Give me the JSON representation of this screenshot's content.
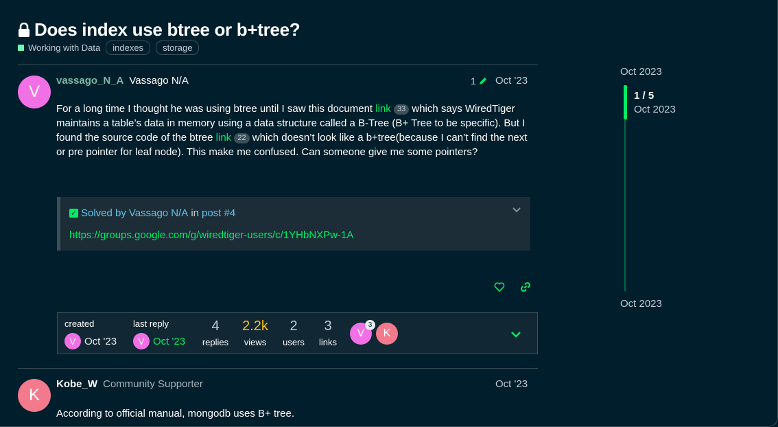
{
  "topic": {
    "title": "Does index use btree or b+tree?",
    "category": "Working with Data",
    "tags": [
      "indexes",
      "storage"
    ]
  },
  "colors": {
    "background": "#001e2b",
    "accent_green": "#00ed64",
    "category": "#71f6ba",
    "views_hot": "#ffc010"
  },
  "post1": {
    "avatar_letter": "V",
    "username": "vassago_N_A",
    "fullname": "Vassago N/A",
    "edits": "1",
    "date": "Oct '23",
    "text_1": "For a long time I thought he was using btree until I saw this document ",
    "link_1": "link",
    "link_1_clicks": "33",
    "text_2": " which says WiredTiger maintains a table’s data in memory using a data structure called a B-Tree (B+ Tree to be specific). But I found the source code of the btree ",
    "link_2": "link",
    "link_2_clicks": "22",
    "text_3": " which doesn’t look like a b+tree(because I can’t find the next or pre pointer for leaf node). This make me confused. Can someone give me some pointers?",
    "solution": {
      "solved_by": "Solved by",
      "author": "Vassago N/A",
      "in": "in",
      "post_ref": "post #4",
      "url": "https://groups.google.com/g/wiredtiger-users/c/1YHbNXPw-1A"
    }
  },
  "topic_map": {
    "created_label": "created",
    "created_date": "Oct '23",
    "last_reply_label": "last reply",
    "last_reply_date": "Oct '23",
    "replies": "4",
    "replies_label": "replies",
    "views": "2.2k",
    "views_label": "views",
    "users": "2",
    "users_label": "users",
    "links": "3",
    "links_label": "links",
    "participants": [
      {
        "letter": "V",
        "count": "3"
      },
      {
        "letter": "K",
        "count": ""
      }
    ]
  },
  "post2": {
    "avatar_letter": "K",
    "username": "Kobe_W",
    "user_title": "Community Supporter",
    "date": "Oct '23",
    "text": "According to official manual, mongodb uses B+ tree."
  },
  "timeline": {
    "start_date": "Oct 2023",
    "position": "1 / 5",
    "position_date": "Oct 2023",
    "end_date": "Oct 2023"
  }
}
